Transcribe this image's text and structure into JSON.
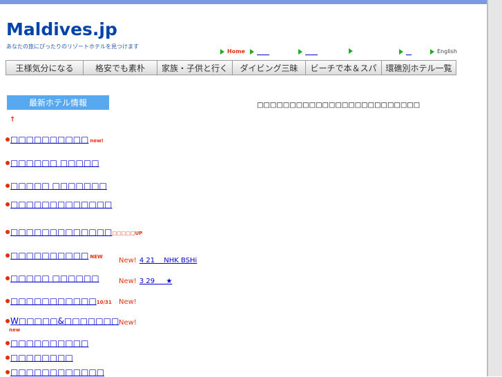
{
  "header": {
    "logo": "Maldives.jp",
    "tagline": "あなたの旅にぴったりのリゾートホテルを見つけます"
  },
  "topnav": [
    {
      "label": "Home",
      "style": "red"
    },
    {
      "label": "",
      "style": "blank"
    },
    {
      "label": "",
      "style": "blank"
    },
    {
      "label": "",
      "style": "none"
    },
    {
      "label": "",
      "style": "blank-short"
    },
    {
      "label": "English",
      "style": "gray"
    }
  ],
  "menu": [
    "王様気分になる",
    "格安でも素朴",
    "家族・子供と行く",
    "ダイビング三昧",
    "ビーチで本＆スパ",
    "環礁別ホテル一覧"
  ],
  "sidebar": {
    "heading": "最新ホテル情報",
    "up_arrow": "↑",
    "items": [
      {
        "label": "□□□□□□□□□□",
        "tag": "new!"
      },
      {
        "label": " □□□□□□ □□□□□",
        "tag": ""
      },
      {
        "label": "□□□□□ □□□□□□□",
        "tag": ""
      },
      {
        "label": "□□□□□□□□□□□□□",
        "tag": ""
      },
      {
        "label": "□□□□□□□□□□□□□",
        "tag": "□□□□□UP"
      },
      {
        "label": "□□□□□□□□□□",
        "tag": "NEW"
      },
      {
        "label": "□□□□□ □□□□□□",
        "tag": ""
      },
      {
        "label": " □□□□□□□□□□□",
        "tag": "10/31"
      },
      {
        "label": " W□□□□□&□□□□□□□",
        "tag": ""
      },
      {
        "label": " □□□□□□□□□□",
        "tag": ""
      },
      {
        "label": " □□□□□□□□",
        "tag": ""
      },
      {
        "label": " □□□□□□□□□□□□",
        "tag": ""
      }
    ],
    "lower_tag": "new"
  },
  "main": {
    "title": "□□□□□□□□□□□□□□□□□□□□□□□□□",
    "news": [
      {
        "new_label": "New!",
        "text": " 4 21 　NHK BSHi"
      },
      {
        "new_label": "New!",
        "text": " 3 29 　 ★"
      },
      {
        "new_label": "New!",
        "text": ""
      },
      {
        "new_label": "New!",
        "text": ""
      }
    ]
  }
}
